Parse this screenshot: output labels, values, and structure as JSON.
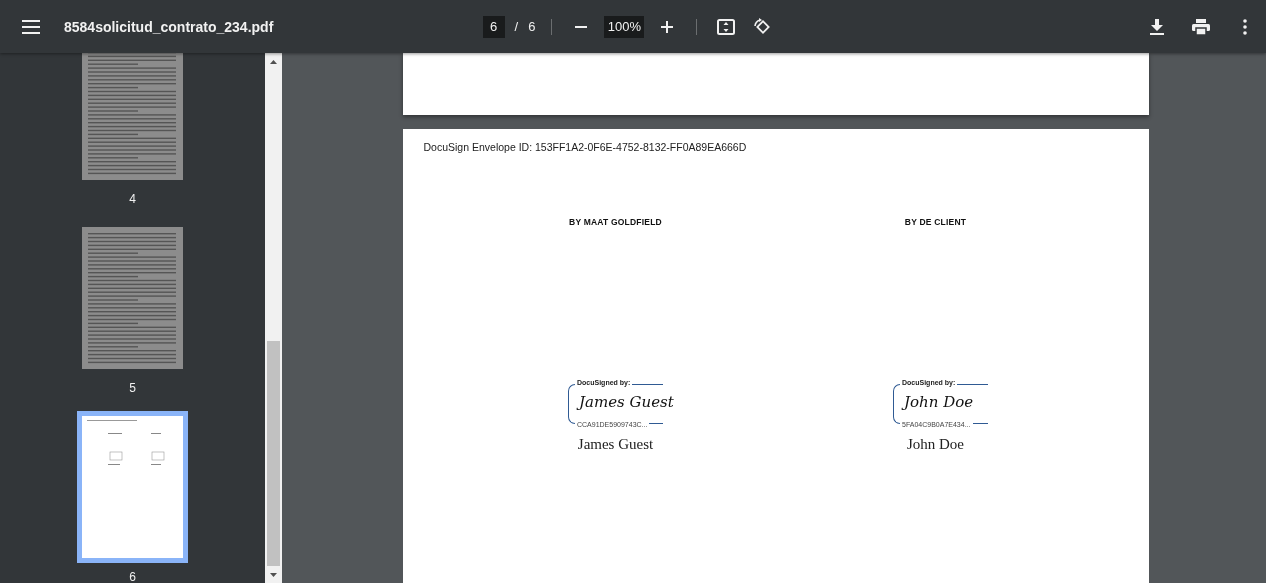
{
  "toolbar": {
    "title": "8584solicitud_contrato_234.pdf",
    "page_input": "6",
    "page_separator": "/",
    "page_total": "6",
    "zoom_value": "100%"
  },
  "thumbnails": [
    {
      "label": "4",
      "selected": false,
      "kind": "text"
    },
    {
      "label": "5",
      "selected": false,
      "kind": "text"
    },
    {
      "label": "6",
      "selected": true,
      "kind": "signature"
    }
  ],
  "document": {
    "envelope_id": "DocuSign Envelope ID: 153FF1A2-0F6E-4752-8132-FF0A89EA666D",
    "signers": [
      {
        "heading": "BY MAAT GOLDFIELD",
        "stamp_label": "DocuSigned by:",
        "signature": "James Guest",
        "stamp_id": "CCA91DE5909743C...",
        "name": "James Guest"
      },
      {
        "heading": "BY DE CLIENT",
        "stamp_label": "DocuSigned by:",
        "signature": "John Doe",
        "stamp_id": "5FA04C9B0A7E434...",
        "name": "John Doe"
      }
    ]
  }
}
